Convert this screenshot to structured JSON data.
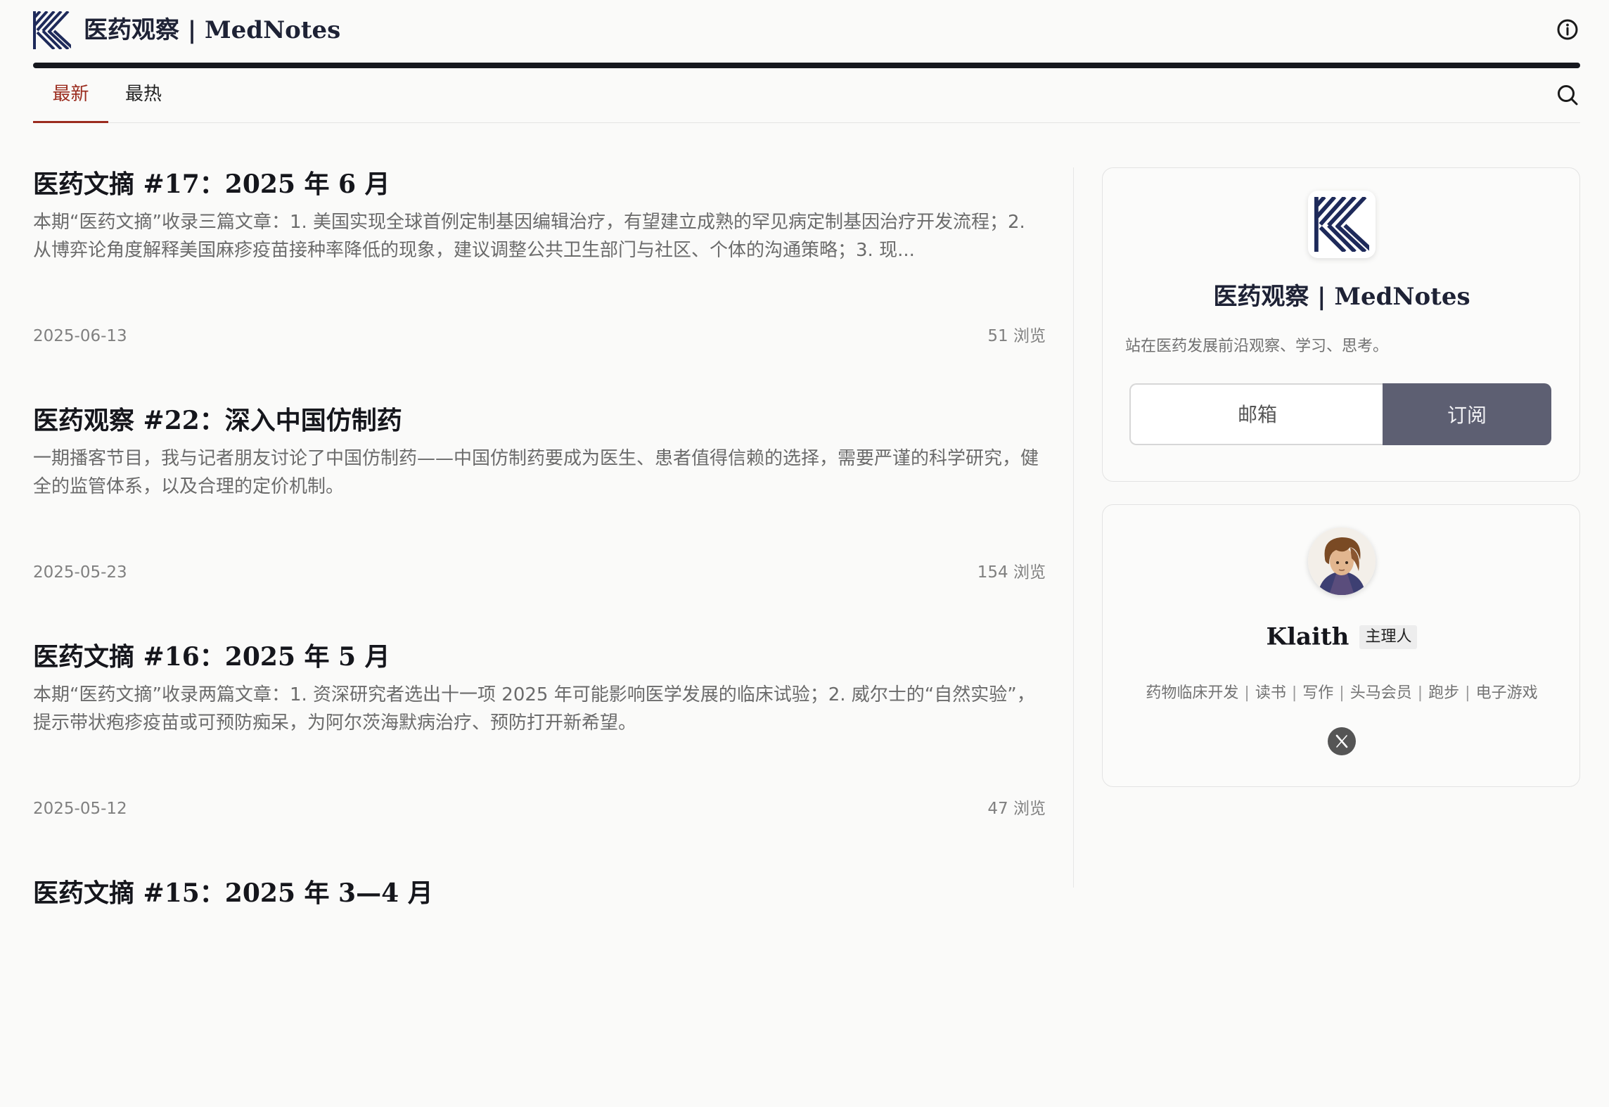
{
  "site": {
    "title": "医药观察 | MedNotes",
    "tagline": "站在医药发展前沿观察、学习、思考。"
  },
  "tabs": [
    {
      "label": "最新",
      "active": true
    },
    {
      "label": "最热",
      "active": false
    }
  ],
  "articles": [
    {
      "title": "医药文摘 #17：2025 年 6 月",
      "excerpt": "本期“医药文摘”收录三篇文章：1. 美国实现全球首例定制基因编辑治疗，有望建立成熟的罕见病定制基因治疗开发流程；2. 从博弈论角度解释美国麻疹疫苗接种率降低的现象，建议调整公共卫生部门与社区、个体的沟通策略；3. 现...",
      "date": "2025-06-13",
      "views": "51 浏览"
    },
    {
      "title": "医药观察 #22：深入中国仿制药",
      "excerpt": "一期播客节目，我与记者朋友讨论了中国仿制药——中国仿制药要成为医生、患者值得信赖的选择，需要严谨的科学研究，健全的监管体系，以及合理的定价机制。",
      "date": "2025-05-23",
      "views": "154 浏览"
    },
    {
      "title": "医药文摘 #16：2025 年 5 月",
      "excerpt": "本期“医药文摘”收录两篇文章：1. 资深研究者选出十一项 2025 年可能影响医学发展的临床试验；2. 威尔士的“自然实验”，提示带状疱疹疫苗或可预防痴呆，为阿尔茨海默病治疗、预防打开新希望。",
      "date": "2025-05-12",
      "views": "47 浏览"
    },
    {
      "title": "医药文摘 #15：2025 年 3—4 月",
      "excerpt": "",
      "date": "",
      "views": ""
    }
  ],
  "subscribe": {
    "email_placeholder": "邮箱",
    "button_label": "订阅"
  },
  "author": {
    "name": "Klaith",
    "badge": "主理人",
    "tags": [
      "药物临床开发",
      "读书",
      "写作",
      "头马会员",
      "跑步",
      "电子游戏"
    ],
    "tag_separator": "|"
  },
  "icons": {
    "info": "info-icon",
    "search": "search-icon",
    "logo": "mednotes-logo-icon",
    "x": "x-logo-icon"
  },
  "colors": {
    "accent": "#9b2c1f",
    "brand": "#1e2a5a",
    "subscribe_button": "#5d5f72"
  }
}
